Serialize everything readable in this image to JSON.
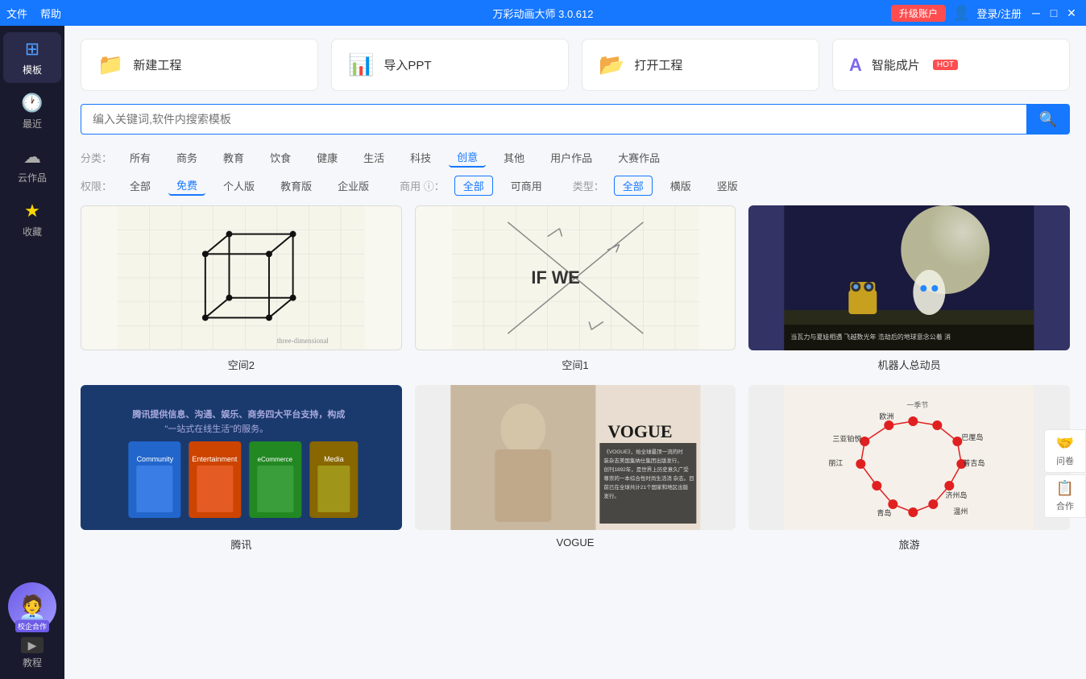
{
  "titlebar": {
    "title": "万彩动画大师 3.0.612",
    "menu_file": "文件",
    "menu_help": "帮助",
    "upgrade_label": "升级账户",
    "login_label": "登录/注册",
    "window_minimize": "─",
    "window_restore": "□",
    "window_close": "✕"
  },
  "sidebar": {
    "items": [
      {
        "id": "template",
        "label": "模板",
        "icon": "⊞",
        "active": true
      },
      {
        "id": "recent",
        "label": "最近",
        "icon": "🕐"
      },
      {
        "id": "cloud",
        "label": "云作品",
        "icon": "☁"
      },
      {
        "id": "favorite",
        "label": "收藏",
        "icon": "★"
      }
    ],
    "campus_label": "校企合作",
    "tutorial_label": "教程",
    "tutorial_icon": "▶"
  },
  "actions": [
    {
      "id": "new",
      "label": "新建工程",
      "icon": "📁",
      "color": "blue"
    },
    {
      "id": "import",
      "label": "导入PPT",
      "icon": "📊",
      "color": "orange"
    },
    {
      "id": "open",
      "label": "打开工程",
      "icon": "📂",
      "color": "yellow"
    },
    {
      "id": "smart",
      "label": "智能成片",
      "hot": "HOT",
      "icon": "🅐",
      "color": "purple"
    }
  ],
  "search": {
    "placeholder": "编入关键词,软件内搜索模板"
  },
  "filters": {
    "category_label": "分类：",
    "categories": [
      "所有",
      "商务",
      "教育",
      "饮食",
      "健康",
      "生活",
      "科技",
      "创意",
      "其他",
      "用户作品",
      "大赛作品"
    ],
    "active_category": "创意",
    "permission_label": "权限：",
    "permissions": [
      "全部",
      "免费",
      "个人版",
      "教育版",
      "企业版"
    ],
    "active_permission": "免费",
    "commercial_label": "商用 ⓘ：",
    "commercials": [
      "全部",
      "可商用"
    ],
    "active_commercial": "全部",
    "type_label": "类型：",
    "types": [
      "全部",
      "横版",
      "竖版"
    ],
    "active_type": "全部"
  },
  "templates": [
    {
      "id": "t1",
      "name": "空间2",
      "type": "cube"
    },
    {
      "id": "t2",
      "name": "空间1",
      "type": "ifwe"
    },
    {
      "id": "t3",
      "name": "机器人总动员",
      "type": "wall-e"
    },
    {
      "id": "t4",
      "name": "腾讯",
      "type": "tencent"
    },
    {
      "id": "t5",
      "name": "VOGUE",
      "type": "vogue"
    },
    {
      "id": "t6",
      "name": "旅游",
      "type": "travel"
    }
  ],
  "right_float": [
    {
      "id": "survey",
      "label": "问卷",
      "icon": "🤝"
    },
    {
      "id": "collab",
      "label": "合作",
      "icon": "📋"
    }
  ]
}
